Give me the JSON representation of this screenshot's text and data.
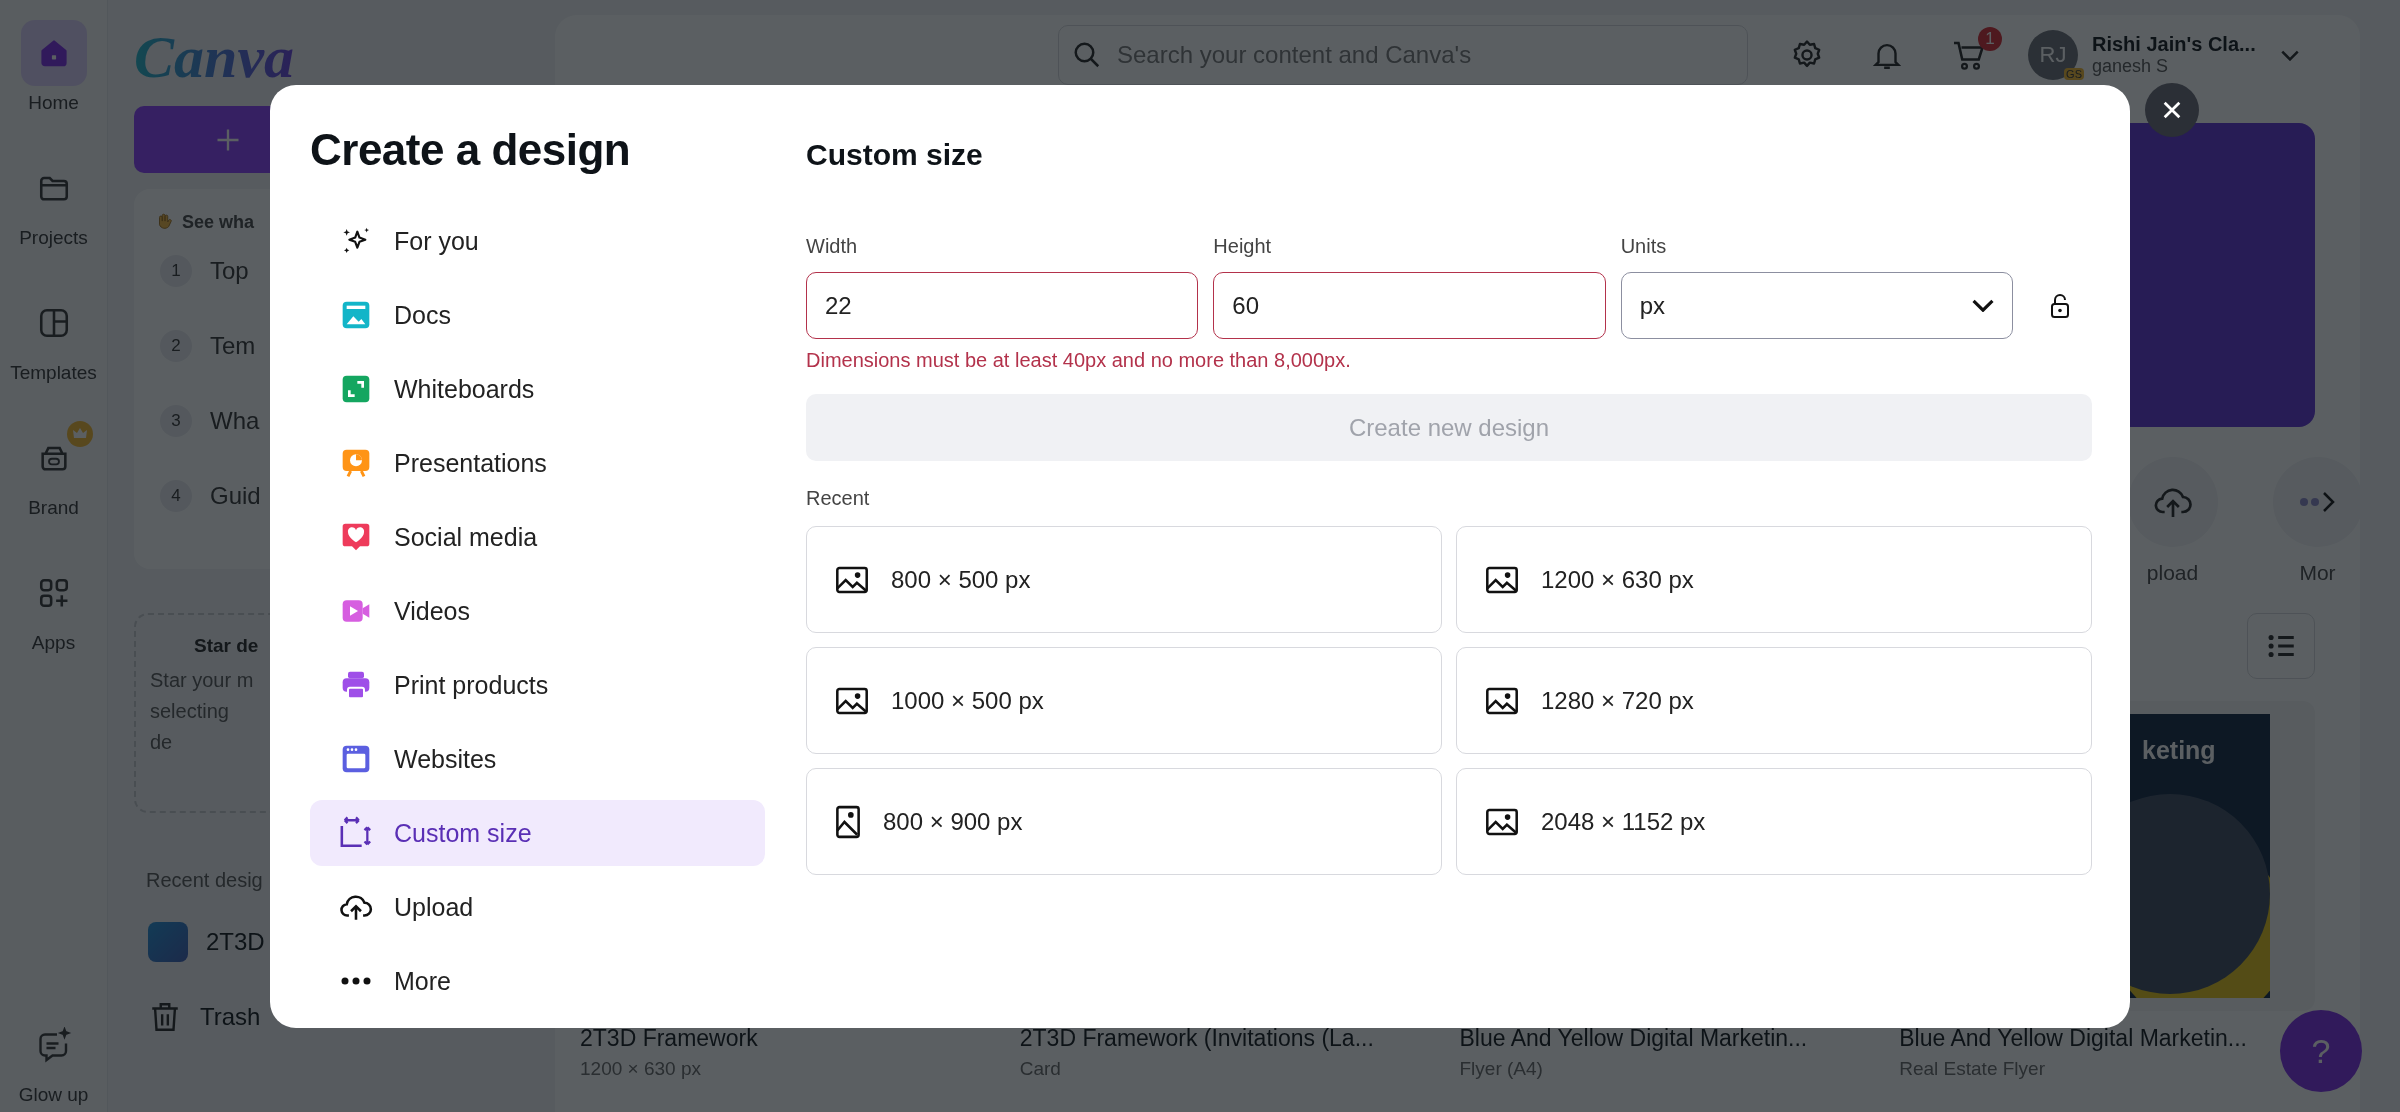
{
  "rail": [
    {
      "label": "Home",
      "selected": true
    },
    {
      "label": "Projects",
      "selected": false
    },
    {
      "label": "Templates",
      "selected": false
    },
    {
      "label": "Brand",
      "selected": false
    },
    {
      "label": "Apps",
      "selected": false
    }
  ],
  "rail_bottom": {
    "label": "Glow up"
  },
  "logo": "Canva",
  "whats_new": {
    "heading": "See wha",
    "items": [
      {
        "number": "1",
        "label": "Top"
      },
      {
        "number": "2",
        "label": "Tem"
      },
      {
        "number": "3",
        "label": "Wha"
      },
      {
        "number": "4",
        "label": "Guid"
      }
    ]
  },
  "star_panel": {
    "title": "Star de",
    "lines": [
      "Star your m",
      "selecting",
      "de"
    ]
  },
  "recent_designs": {
    "heading": "Recent desig",
    "items": [
      {
        "label": "2T3D"
      }
    ]
  },
  "trash": "Trash",
  "search": {
    "placeholder": "Search your content and Canva's"
  },
  "cart_badge": "1",
  "account": {
    "initials": "RJ",
    "team_badge": "GS",
    "name": "Rishi Jain's Cla...",
    "subtitle": "ganesh S"
  },
  "shortcuts": [
    {
      "label": "pload"
    },
    {
      "label": "Mor"
    }
  ],
  "thumbnail_text": "keting",
  "designs": [
    {
      "title": "2T3D Framework",
      "subtitle": "1200 × 630 px"
    },
    {
      "title": "2T3D Framework (Invitations (La...",
      "subtitle": "Card"
    },
    {
      "title": "Blue And Yellow Digital Marketin...",
      "subtitle": "Flyer (A4)"
    },
    {
      "title": "Blue And Yellow Digital Marketin...",
      "subtitle": "Real Estate Flyer"
    }
  ],
  "help": "?",
  "modal": {
    "title": "Create a design",
    "nav": [
      {
        "label": "For you",
        "selected": false
      },
      {
        "label": "Docs",
        "selected": false
      },
      {
        "label": "Whiteboards",
        "selected": false
      },
      {
        "label": "Presentations",
        "selected": false
      },
      {
        "label": "Social media",
        "selected": false
      },
      {
        "label": "Videos",
        "selected": false
      },
      {
        "label": "Print products",
        "selected": false
      },
      {
        "label": "Websites",
        "selected": false
      },
      {
        "label": "Custom size",
        "selected": true
      },
      {
        "label": "Upload",
        "selected": false
      },
      {
        "label": "More",
        "selected": false
      }
    ],
    "heading": "Custom size",
    "fields": [
      {
        "label": "Width",
        "value": "22",
        "invalid": true
      },
      {
        "label": "Height",
        "value": "60",
        "invalid": true
      }
    ],
    "units": {
      "label": "Units",
      "value": "px"
    },
    "error": "Dimensions must be at least 40px and no more than 8,000px.",
    "create_button": {
      "label": "Create new design",
      "disabled": true
    },
    "recent_heading": "Recent",
    "recent": [
      {
        "label": "800 × 500 px",
        "kind": "landscape"
      },
      {
        "label": "1200 × 630 px",
        "kind": "landscape"
      },
      {
        "label": "1000 × 500 px",
        "kind": "landscape"
      },
      {
        "label": "1280 × 720 px",
        "kind": "landscape"
      },
      {
        "label": "800 × 900 px",
        "kind": "portrait"
      },
      {
        "label": "2048 × 1152 px",
        "kind": "landscape"
      }
    ]
  }
}
